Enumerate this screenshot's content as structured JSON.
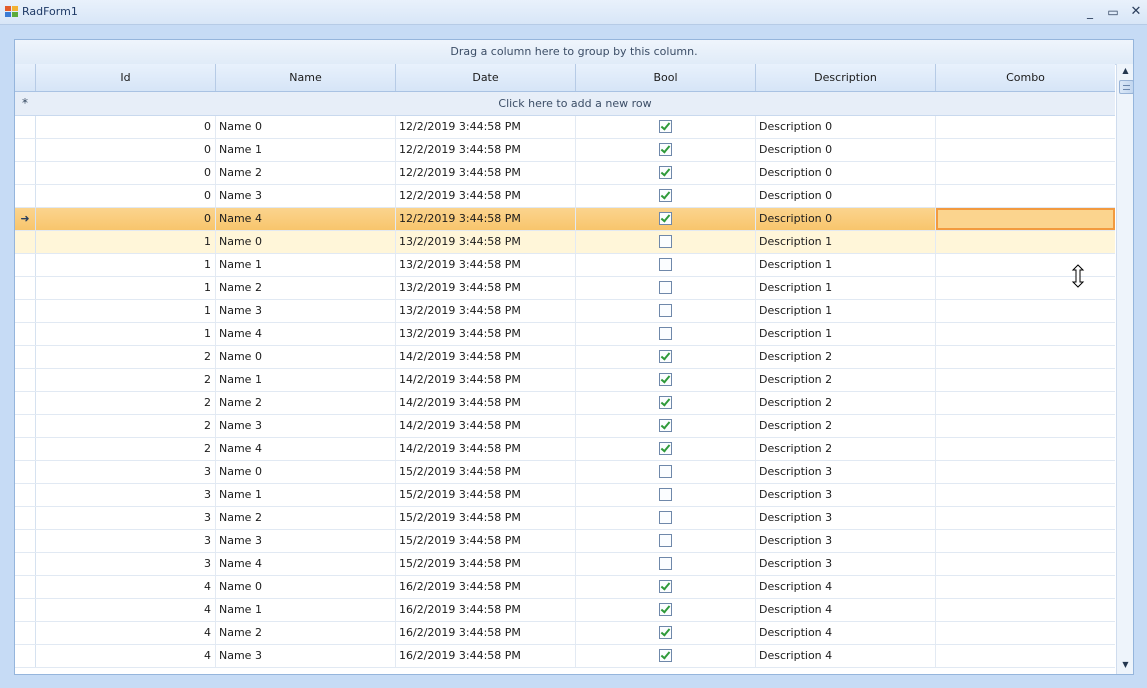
{
  "window": {
    "title": "RadForm1",
    "min_glyph": "_",
    "max_glyph": "▭",
    "close_glyph": "✕"
  },
  "grid": {
    "group_panel_text": "Drag a column here to group by this column.",
    "columns": [
      "Id",
      "Name",
      "Date",
      "Bool",
      "Description",
      "Combo"
    ],
    "new_row_glyph": "*",
    "new_row_text": "Click here to add a new row",
    "current_row_glyph": "➜",
    "selected_row_index": 4,
    "hover_row_index": 5,
    "rows": [
      {
        "id": "0",
        "name": "Name 0",
        "date": "12/2/2019 3:44:58 PM",
        "bool": true,
        "description": "Description 0",
        "combo": ""
      },
      {
        "id": "0",
        "name": "Name 1",
        "date": "12/2/2019 3:44:58 PM",
        "bool": true,
        "description": "Description 0",
        "combo": ""
      },
      {
        "id": "0",
        "name": "Name 2",
        "date": "12/2/2019 3:44:58 PM",
        "bool": true,
        "description": "Description 0",
        "combo": ""
      },
      {
        "id": "0",
        "name": "Name 3",
        "date": "12/2/2019 3:44:58 PM",
        "bool": true,
        "description": "Description 0",
        "combo": ""
      },
      {
        "id": "0",
        "name": "Name 4",
        "date": "12/2/2019 3:44:58 PM",
        "bool": true,
        "description": "Description 0",
        "combo": ""
      },
      {
        "id": "1",
        "name": "Name 0",
        "date": "13/2/2019 3:44:58 PM",
        "bool": false,
        "description": "Description 1",
        "combo": ""
      },
      {
        "id": "1",
        "name": "Name 1",
        "date": "13/2/2019 3:44:58 PM",
        "bool": false,
        "description": "Description 1",
        "combo": ""
      },
      {
        "id": "1",
        "name": "Name 2",
        "date": "13/2/2019 3:44:58 PM",
        "bool": false,
        "description": "Description 1",
        "combo": ""
      },
      {
        "id": "1",
        "name": "Name 3",
        "date": "13/2/2019 3:44:58 PM",
        "bool": false,
        "description": "Description 1",
        "combo": ""
      },
      {
        "id": "1",
        "name": "Name 4",
        "date": "13/2/2019 3:44:58 PM",
        "bool": false,
        "description": "Description 1",
        "combo": ""
      },
      {
        "id": "2",
        "name": "Name 0",
        "date": "14/2/2019 3:44:58 PM",
        "bool": true,
        "description": "Description 2",
        "combo": ""
      },
      {
        "id": "2",
        "name": "Name 1",
        "date": "14/2/2019 3:44:58 PM",
        "bool": true,
        "description": "Description 2",
        "combo": ""
      },
      {
        "id": "2",
        "name": "Name 2",
        "date": "14/2/2019 3:44:58 PM",
        "bool": true,
        "description": "Description 2",
        "combo": ""
      },
      {
        "id": "2",
        "name": "Name 3",
        "date": "14/2/2019 3:44:58 PM",
        "bool": true,
        "description": "Description 2",
        "combo": ""
      },
      {
        "id": "2",
        "name": "Name 4",
        "date": "14/2/2019 3:44:58 PM",
        "bool": true,
        "description": "Description 2",
        "combo": ""
      },
      {
        "id": "3",
        "name": "Name 0",
        "date": "15/2/2019 3:44:58 PM",
        "bool": false,
        "description": "Description 3",
        "combo": ""
      },
      {
        "id": "3",
        "name": "Name 1",
        "date": "15/2/2019 3:44:58 PM",
        "bool": false,
        "description": "Description 3",
        "combo": ""
      },
      {
        "id": "3",
        "name": "Name 2",
        "date": "15/2/2019 3:44:58 PM",
        "bool": false,
        "description": "Description 3",
        "combo": ""
      },
      {
        "id": "3",
        "name": "Name 3",
        "date": "15/2/2019 3:44:58 PM",
        "bool": false,
        "description": "Description 3",
        "combo": ""
      },
      {
        "id": "3",
        "name": "Name 4",
        "date": "15/2/2019 3:44:58 PM",
        "bool": false,
        "description": "Description 3",
        "combo": ""
      },
      {
        "id": "4",
        "name": "Name 0",
        "date": "16/2/2019 3:44:58 PM",
        "bool": true,
        "description": "Description 4",
        "combo": ""
      },
      {
        "id": "4",
        "name": "Name 1",
        "date": "16/2/2019 3:44:58 PM",
        "bool": true,
        "description": "Description 4",
        "combo": ""
      },
      {
        "id": "4",
        "name": "Name 2",
        "date": "16/2/2019 3:44:58 PM",
        "bool": true,
        "description": "Description 4",
        "combo": ""
      },
      {
        "id": "4",
        "name": "Name 3",
        "date": "16/2/2019 3:44:58 PM",
        "bool": true,
        "description": "Description 4",
        "combo": ""
      }
    ]
  },
  "scrollbar": {
    "up_glyph": "▲",
    "down_glyph": "▼"
  },
  "icons": {
    "app": "grid-app-icon",
    "cursor": "resize-vertical-cursor-icon"
  },
  "colors": {
    "selected_row": "#f8c56c",
    "hover_row": "#fff6d9",
    "current_cell_border": "#f29a3f",
    "checkmark": "#2f9a3a"
  }
}
